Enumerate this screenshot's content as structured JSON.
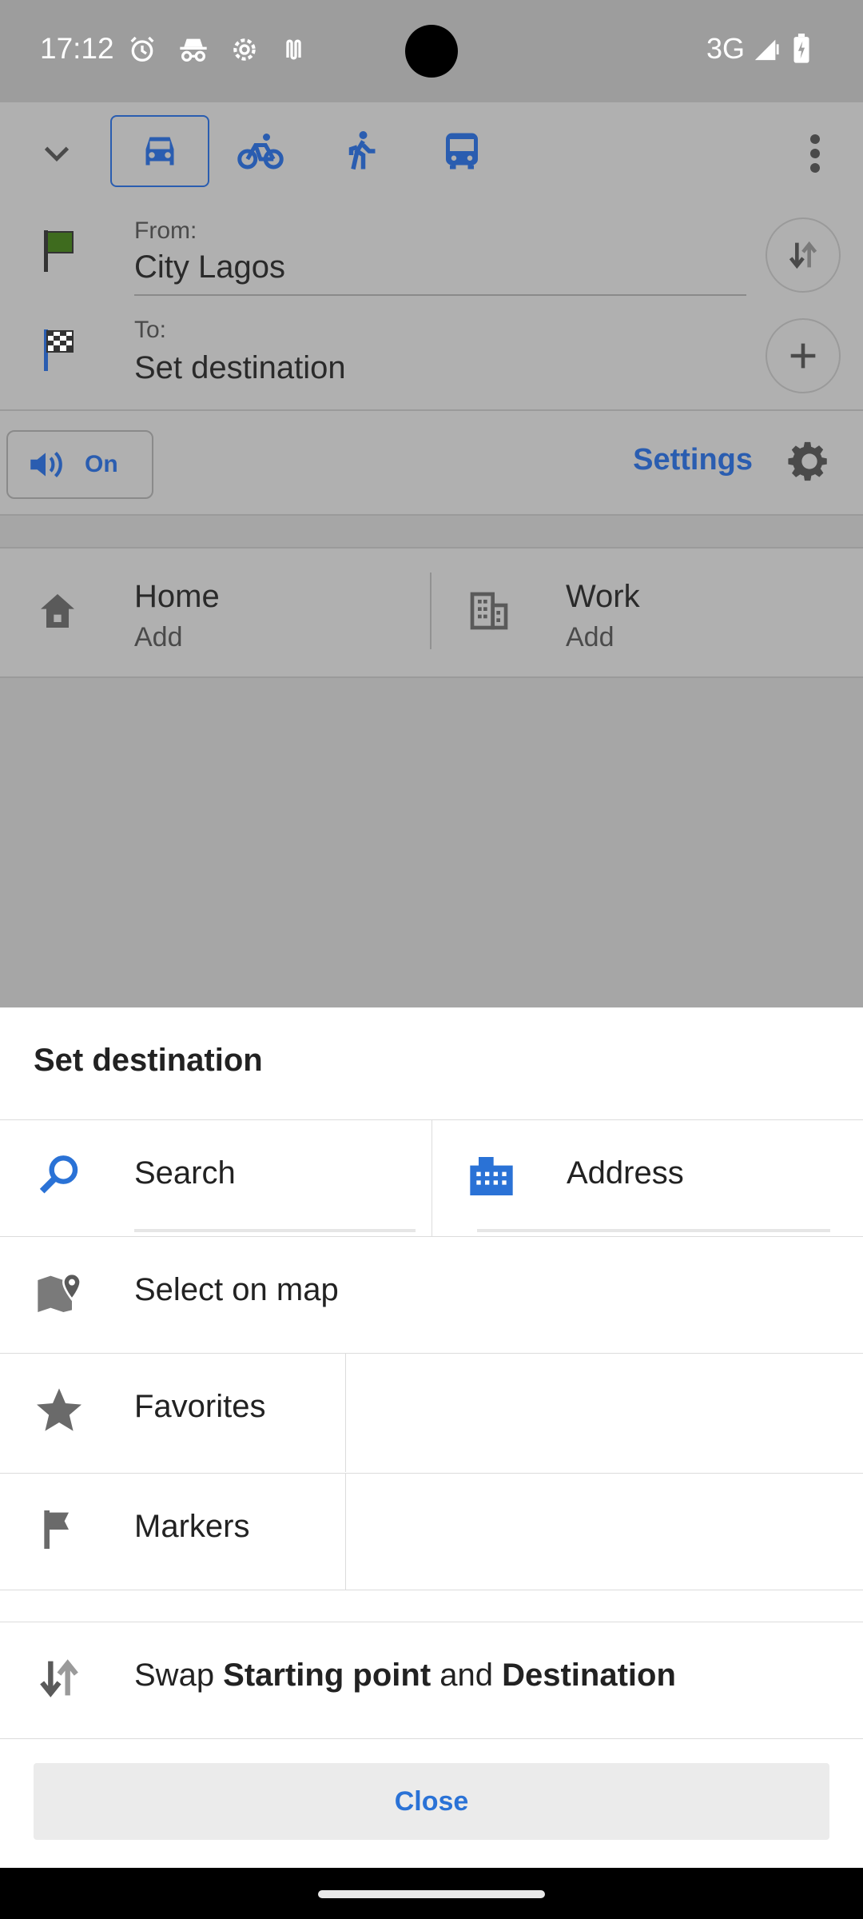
{
  "status_bar": {
    "time": "17:12",
    "network": "3G",
    "icons": [
      "alarm-icon",
      "incognito-icon",
      "settings-sync-icon",
      "nfc-icon"
    ]
  },
  "route": {
    "from_label": "From:",
    "from_value": "City Lagos",
    "to_label": "To:",
    "to_value": "Set destination",
    "modes": [
      "car-icon",
      "bicycle-icon",
      "pedestrian-icon",
      "bus-icon"
    ],
    "selected_mode": "car-icon"
  },
  "sound": {
    "toggle_label": "On"
  },
  "settings": {
    "label": "Settings"
  },
  "places": {
    "home_title": "Home",
    "home_sub": "Add",
    "work_title": "Work",
    "work_sub": "Add"
  },
  "sheet": {
    "title": "Set destination",
    "search_label": "Search",
    "address_label": "Address",
    "select_on_map_label": "Select on map",
    "favorites_label": "Favorites",
    "markers_label": "Markers",
    "swap_prefix": "Swap ",
    "swap_start": "Starting point",
    "swap_and": " and ",
    "swap_dest": "Destination",
    "close_label": "Close"
  },
  "colors": {
    "accent": "#2a72d6",
    "dim_accent": "#2a5db0",
    "from_flag": "#3e6b1e"
  }
}
